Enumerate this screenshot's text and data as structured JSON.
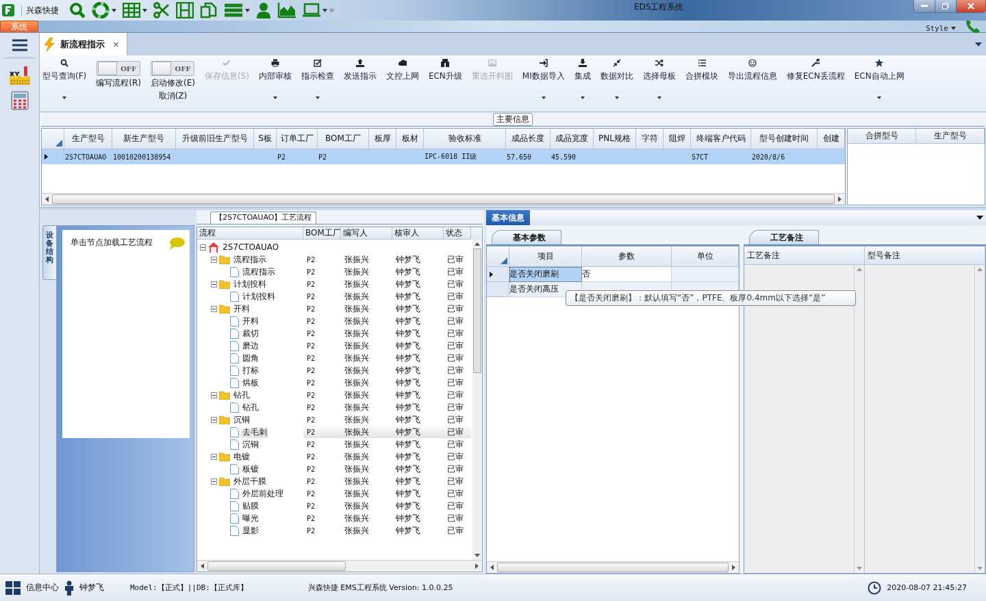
{
  "app_name": "兴森快捷",
  "window": {
    "title": "EDS工程系统"
  },
  "ribbon": {
    "tab": {
      "label": "系统",
      "selected": true
    },
    "style_menu": "Style"
  },
  "doc_tabs": [
    {
      "label": "新流程指示",
      "selected": true,
      "close": "×"
    }
  ],
  "toolbar": [
    {
      "kind": "button",
      "label": "型号查询(F)",
      "disabled": false,
      "dropdown": true
    },
    {
      "kind": "toggle",
      "label": "编写流程(R)",
      "on": false,
      "state_text": "OFF"
    },
    {
      "kind": "toggle",
      "label": "启动修改(E)",
      "second_line": "取消(Z)",
      "on": false,
      "state_text": "OFF"
    },
    {
      "kind": "button",
      "label": "保存信息(S)",
      "disabled": true,
      "dropdown": false
    },
    {
      "kind": "button",
      "label": "内部审核",
      "disabled": false,
      "dropdown": true
    },
    {
      "kind": "button",
      "label": "指示检查",
      "disabled": false,
      "dropdown": true
    },
    {
      "kind": "button",
      "label": "发送指示",
      "disabled": false,
      "dropdown": false
    },
    {
      "kind": "button",
      "label": "文控上网",
      "disabled": false,
      "dropdown": false
    },
    {
      "kind": "button",
      "label": "ECN升级",
      "disabled": false,
      "dropdown": false
    },
    {
      "kind": "button",
      "label": "重选开料图",
      "disabled": true,
      "dropdown": false
    },
    {
      "kind": "button",
      "label": "MI数据导入",
      "disabled": false,
      "dropdown": true
    },
    {
      "kind": "button",
      "label": "集成",
      "disabled": false,
      "dropdown": true
    },
    {
      "kind": "button",
      "label": "数据对比",
      "disabled": false,
      "dropdown": true
    },
    {
      "kind": "button",
      "label": "选择母板",
      "disabled": false,
      "dropdown": true
    },
    {
      "kind": "button",
      "label": "合拼模块",
      "disabled": false,
      "dropdown": false
    },
    {
      "kind": "button",
      "label": "导出流程信息",
      "disabled": false,
      "dropdown": false
    },
    {
      "kind": "button",
      "label": "修复ECN丢流程",
      "disabled": false,
      "dropdown": false
    },
    {
      "kind": "button",
      "label": "ECN自动上网",
      "disabled": false,
      "dropdown": true
    }
  ],
  "main_info": {
    "title": "主要信息",
    "table": {
      "columns": [
        "生产型号",
        "新生产型号",
        "升级前旧生产型号",
        "S板",
        "订单工厂",
        "BOM工厂",
        "板厚",
        "板材",
        "验收标准",
        "成品长度",
        "成品宽度",
        "PNL规格",
        "字符",
        "阻焊",
        "终端客户代码",
        "型号创建时间",
        "创建"
      ],
      "rows": [
        {
          "selected": true,
          "cells": [
            "2S7CTOAUAO",
            "10010200138954",
            null,
            null,
            "P2",
            "P2",
            null,
            null,
            "IPC-6018 II级",
            "57.650",
            "45.590",
            null,
            null,
            null,
            "S7CT",
            "2020/8/6",
            null
          ]
        }
      ]
    },
    "side_table": {
      "columns": [
        "合拼型号",
        "生产型号"
      ]
    }
  },
  "left_panel": {
    "vertical_tab": "设备结构",
    "item": "单击节点加载工艺流程"
  },
  "process_tree": {
    "title": "【2S7CTOAUAO】工艺流程",
    "columns": [
      "流程",
      "BOM工厂",
      "编写人",
      "核审人",
      "状态"
    ],
    "root": {
      "label": "2S7CTOAUAO",
      "expanded": true,
      "selected": false,
      "children": [
        {
          "label": "流程指示",
          "bom": "P2",
          "writer": "张振兴",
          "reviewer": "钟梦飞",
          "status": "已审",
          "expanded": true,
          "selected": false,
          "children": [
            {
              "label": "流程指示",
              "bom": "P2",
              "writer": "张振兴",
              "reviewer": "钟梦飞",
              "status": "已审",
              "selected": false
            }
          ]
        },
        {
          "label": "计划投料",
          "bom": "P2",
          "writer": "张振兴",
          "reviewer": "钟梦飞",
          "status": "已审",
          "expanded": true,
          "selected": false,
          "children": [
            {
              "label": "计划投料",
              "bom": "P2",
              "writer": "张振兴",
              "reviewer": "钟梦飞",
              "status": "已审",
              "selected": false
            }
          ]
        },
        {
          "label": "开料",
          "bom": "P2",
          "writer": "张振兴",
          "reviewer": "钟梦飞",
          "status": "已审",
          "expanded": true,
          "selected": false,
          "children": [
            {
              "label": "开料",
              "bom": "P2",
              "writer": "张振兴",
              "reviewer": "钟梦飞",
              "status": "已审",
              "selected": false
            },
            {
              "label": "裁切",
              "bom": "P2",
              "writer": "张振兴",
              "reviewer": "钟梦飞",
              "status": "已审",
              "selected": false
            },
            {
              "label": "磨边",
              "bom": "P2",
              "writer": "张振兴",
              "reviewer": "钟梦飞",
              "status": "已审",
              "selected": false
            },
            {
              "label": "圆角",
              "bom": "P2",
              "writer": "张振兴",
              "reviewer": "钟梦飞",
              "status": "已审",
              "selected": false
            },
            {
              "label": "打标",
              "bom": "P2",
              "writer": "张振兴",
              "reviewer": "钟梦飞",
              "status": "已审",
              "selected": false
            },
            {
              "label": "烘板",
              "bom": "P2",
              "writer": "张振兴",
              "reviewer": "钟梦飞",
              "status": "已审",
              "selected": false
            }
          ]
        },
        {
          "label": "钻孔",
          "bom": "P2",
          "writer": "张振兴",
          "reviewer": "钟梦飞",
          "status": "已审",
          "expanded": true,
          "selected": false,
          "children": [
            {
              "label": "钻孔",
              "bom": "P2",
              "writer": "张振兴",
              "reviewer": "钟梦飞",
              "status": "已审",
              "selected": false
            }
          ]
        },
        {
          "label": "沉铜",
          "bom": "P2",
          "writer": "张振兴",
          "reviewer": "钟梦飞",
          "status": "已审",
          "expanded": true,
          "selected": false,
          "children": [
            {
              "label": "去毛刺",
              "bom": "P2",
              "writer": "张振兴",
              "reviewer": "钟梦飞",
              "status": "已审",
              "selected": true
            },
            {
              "label": "沉铜",
              "bom": "P2",
              "writer": "张振兴",
              "reviewer": "钟梦飞",
              "status": "已审",
              "selected": false
            }
          ]
        },
        {
          "label": "电镀",
          "bom": "P2",
          "writer": "张振兴",
          "reviewer": "钟梦飞",
          "status": "已审",
          "expanded": true,
          "selected": false,
          "children": [
            {
              "label": "板镀",
              "bom": "P2",
              "writer": "张振兴",
              "reviewer": "钟梦飞",
              "status": "已审",
              "selected": false
            }
          ]
        },
        {
          "label": "外层干膜",
          "bom": "P2",
          "writer": "张振兴",
          "reviewer": "钟梦飞",
          "status": "已审",
          "expanded": true,
          "selected": false,
          "children": [
            {
              "label": "外层前处理",
              "bom": "P2",
              "writer": "张振兴",
              "reviewer": "钟梦飞",
              "status": "已审",
              "selected": false
            },
            {
              "label": "贴膜",
              "bom": "P2",
              "writer": "张振兴",
              "reviewer": "钟梦飞",
              "status": "已审",
              "selected": false
            },
            {
              "label": "曝光",
              "bom": "P2",
              "writer": "张振兴",
              "reviewer": "钟梦飞",
              "status": "已审",
              "selected": false
            },
            {
              "label": "显影",
              "bom": "P2",
              "writer": "张振兴",
              "reviewer": "钟梦飞",
              "status": "已审",
              "selected": false
            }
          ]
        }
      ]
    }
  },
  "basic_info": {
    "tab": {
      "label": "基本信息",
      "selected": true
    },
    "params": {
      "tab": {
        "label": "基本参数",
        "selected": true
      },
      "columns": [
        "项目",
        "参数",
        "单位"
      ],
      "rows": [
        {
          "item": "是否关闭磨刷",
          "value": "否",
          "selected": true
        },
        {
          "item": "是否关闭高压",
          "selected": false
        }
      ],
      "tooltip": "【是否关闭磨刷】：默认填写“否”，PTFE、板厚0.4mm以下选择“是”"
    },
    "notes": {
      "tab": {
        "label": "工艺备注",
        "selected": true
      },
      "columns": [
        "工艺备注",
        "型号备注"
      ]
    }
  },
  "status_bar": {
    "info_center": "信息中心",
    "user": "钟梦飞",
    "model": "Model:【正式】||DB:【正式库】",
    "product": "兴森快捷 EMS工程系统 Version: 1.0.0.25",
    "time": "2020-08-07 21:45:27"
  }
}
